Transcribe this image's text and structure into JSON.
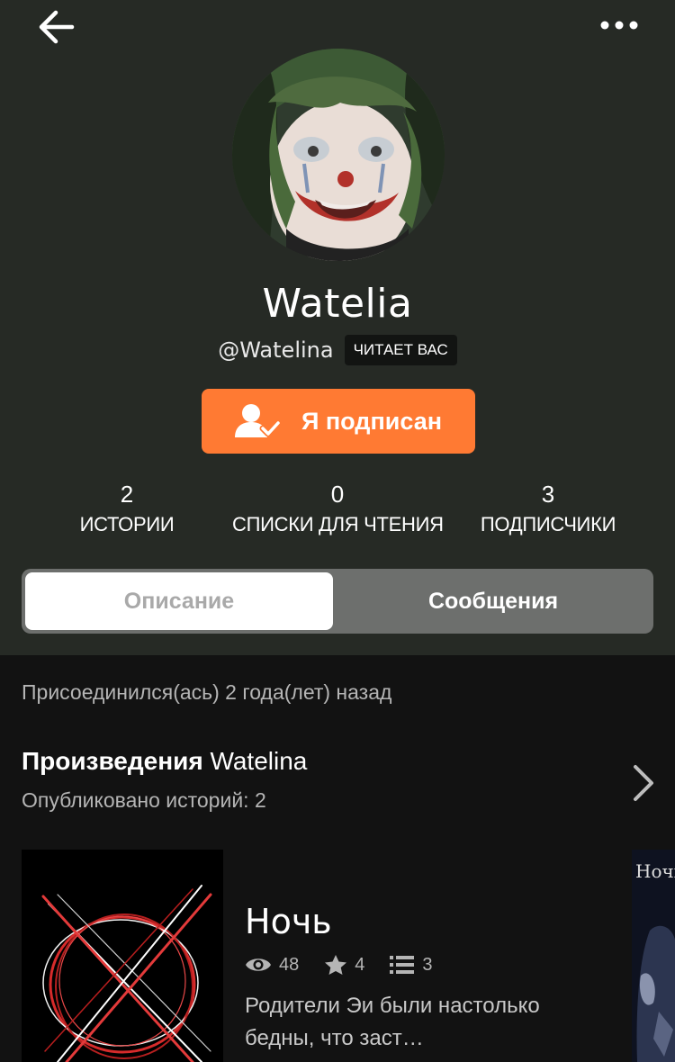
{
  "profile": {
    "display_name": "Watelia",
    "handle": "@Watelina",
    "follows_you_badge": "ЧИТАЕТ ВАС",
    "follow_button_label": "Я подписан"
  },
  "stats": [
    {
      "value": "2",
      "label": "ИСТОРИИ"
    },
    {
      "value": "0",
      "label": "СПИСКИ ДЛЯ ЧТЕНИЯ"
    },
    {
      "value": "3",
      "label": "ПОДПИСЧИКИ"
    }
  ],
  "tabs": {
    "about": "Описание",
    "messages": "Сообщения"
  },
  "joined_text": "Присоединился(ась) 2 года(лет) назад",
  "works": {
    "title_bold": "Произведения",
    "title_user": "Watelina",
    "subtitle": "Опубликовано историй: 2"
  },
  "stories": [
    {
      "title": "Ночь",
      "views": "48",
      "votes": "4",
      "parts": "3",
      "description": "Родители Эи были настолько бедны, что заст…"
    },
    {
      "title": "Ночь"
    }
  ],
  "icons": {
    "back": "arrow-left-icon",
    "more": "more-dots-icon",
    "follow": "user-check-icon",
    "chevron": "chevron-right-icon",
    "views": "eye-icon",
    "votes": "star-icon",
    "parts": "list-icon"
  },
  "colors": {
    "accent": "#ff7a33",
    "header_bg": "#262a25",
    "page_bg": "#121212"
  }
}
